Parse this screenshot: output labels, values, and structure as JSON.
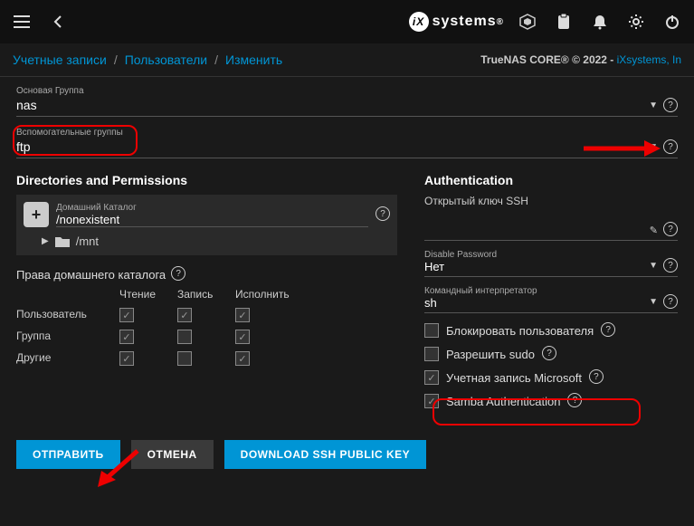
{
  "topbar": {
    "logo_text": "systems"
  },
  "breadcrumbs": {
    "item1": "Учетные записи",
    "item2": "Пользователи",
    "item3": "Изменить"
  },
  "brand": {
    "text": "TrueNAS CORE® © 2022 - ",
    "link": "iXsystems, In"
  },
  "fields": {
    "primary_group_label": "Основая Группа",
    "primary_group_value": "nas",
    "aux_groups_label": "Вспомогательные группы",
    "aux_groups_value": "ftp"
  },
  "sections": {
    "dirs_title": "Directories and Permissions",
    "auth_title": "Authentication"
  },
  "home": {
    "label": "Домашний Каталог",
    "value": "/nonexistent",
    "mnt": "/mnt"
  },
  "perms": {
    "title": "Права домашнего каталога",
    "col_read": "Чтение",
    "col_write": "Запись",
    "col_exec": "Исполнить",
    "row_user": "Пользователь",
    "row_group": "Группа",
    "row_other": "Другие",
    "matrix": {
      "user": {
        "read": true,
        "write": true,
        "exec": true
      },
      "group": {
        "read": true,
        "write": false,
        "exec": true
      },
      "other": {
        "read": true,
        "write": false,
        "exec": true
      }
    }
  },
  "auth": {
    "ssh_label": "Открытый ключ SSH",
    "ssh_value": "",
    "disable_pw_label": "Disable Password",
    "disable_pw_value": "Нет",
    "shell_label": "Командный интерпретатор",
    "shell_value": "sh",
    "lock_user": "Блокировать пользователя",
    "lock_user_checked": false,
    "permit_sudo": "Разрешить sudo",
    "permit_sudo_checked": false,
    "ms_account": "Учетная запись Microsoft",
    "ms_account_checked": true,
    "samba": "Samba Authentication",
    "samba_checked": true
  },
  "buttons": {
    "submit": "ОТПРАВИТЬ",
    "cancel": "ОТМЕНА",
    "download_ssh": "DOWNLOAD SSH PUBLIC KEY"
  }
}
